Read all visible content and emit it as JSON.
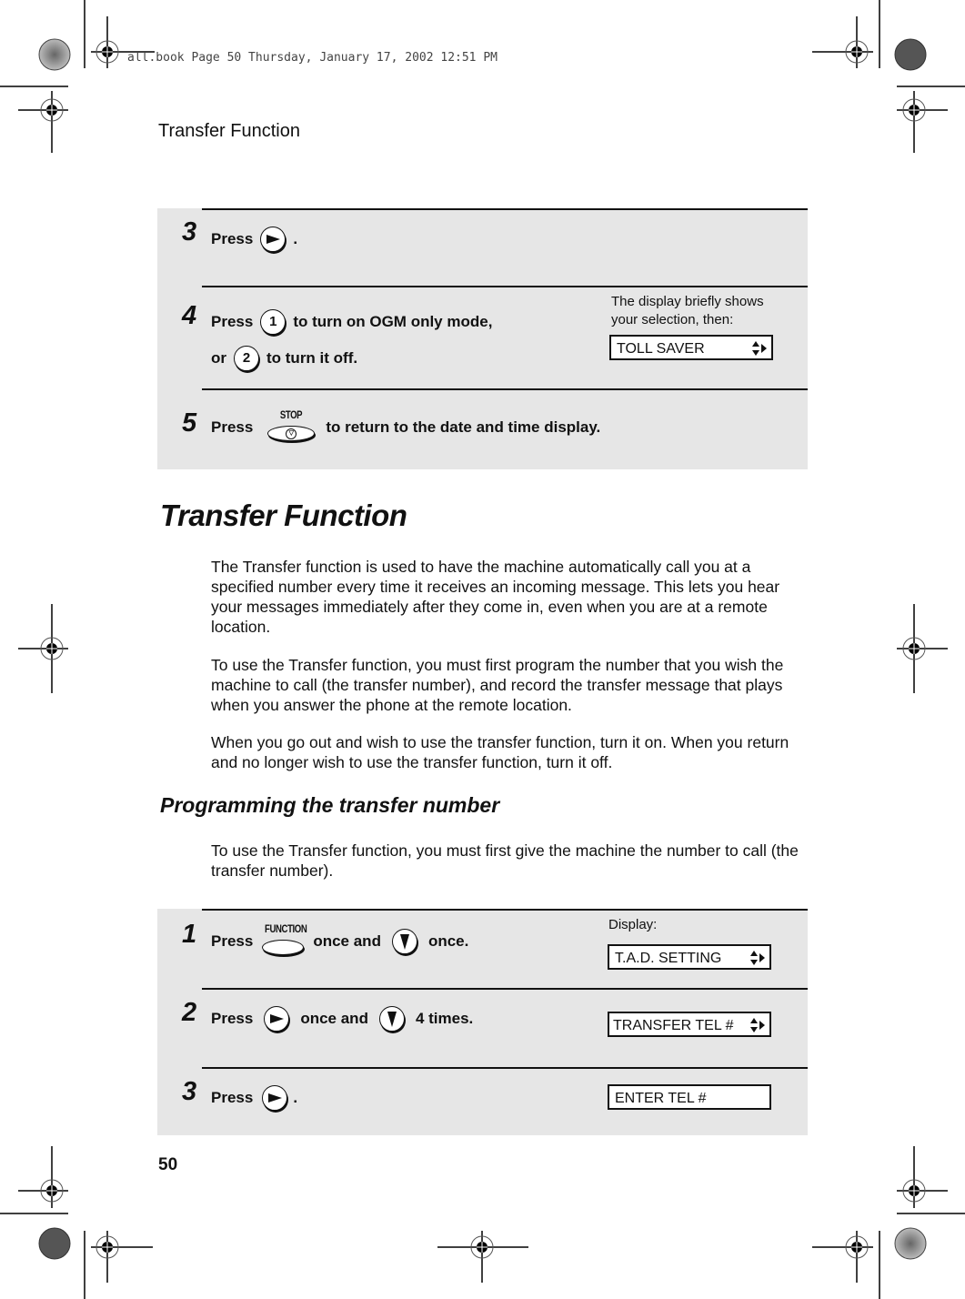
{
  "slug": "all.book  Page 50  Thursday, January 17, 2002  12:51 PM",
  "running_head": "Transfer Function",
  "page_number": "50",
  "top_panel": {
    "steps": [
      {
        "num": "3",
        "parts": [
          "Press",
          "right-arrow-key",
          "."
        ]
      },
      {
        "num": "4",
        "line1": [
          "Press",
          "key-1",
          "to turn on OGM only mode,"
        ],
        "line2": [
          "or",
          "key-2",
          "to turn it off."
        ],
        "keys": [
          "1",
          "2"
        ]
      },
      {
        "num": "5",
        "parts": [
          "Press",
          "stop-key",
          "to return to the date and time display."
        ],
        "key_label": "STOP"
      }
    ],
    "note": "The display briefly shows your selection, then:",
    "display": "TOLL SAVER"
  },
  "section": {
    "title": "Transfer Function",
    "paragraphs": [
      "The Transfer function is used to have the machine automatically call you at a specified number every time it receives an incoming message. This lets you hear your messages immediately after they come in, even when you are at a remote location.",
      "To use the Transfer function, you must first program the number that you wish the machine to call (the transfer number), and record the transfer message that plays when you answer the phone at the remote location.",
      "When you go out and wish to use the transfer function, turn it on. When you return and no longer wish to use the transfer function, turn it off."
    ]
  },
  "subsection": {
    "title": "Programming the transfer number",
    "paragraph": "To use the Transfer function, you must first give the machine the number to call (the transfer number)."
  },
  "bottom_panel": {
    "display_label": "Display:",
    "steps": [
      {
        "num": "1",
        "press": "Press",
        "key_label": "FUNCTION",
        "mid": "once and",
        "end": "once.",
        "display": "T.A.D. SETTING"
      },
      {
        "num": "2",
        "press": "Press",
        "mid": "once and",
        "end": "4 times.",
        "display": "TRANSFER TEL #"
      },
      {
        "num": "3",
        "press": "Press",
        "end": ".",
        "display": "ENTER TEL #"
      }
    ]
  }
}
